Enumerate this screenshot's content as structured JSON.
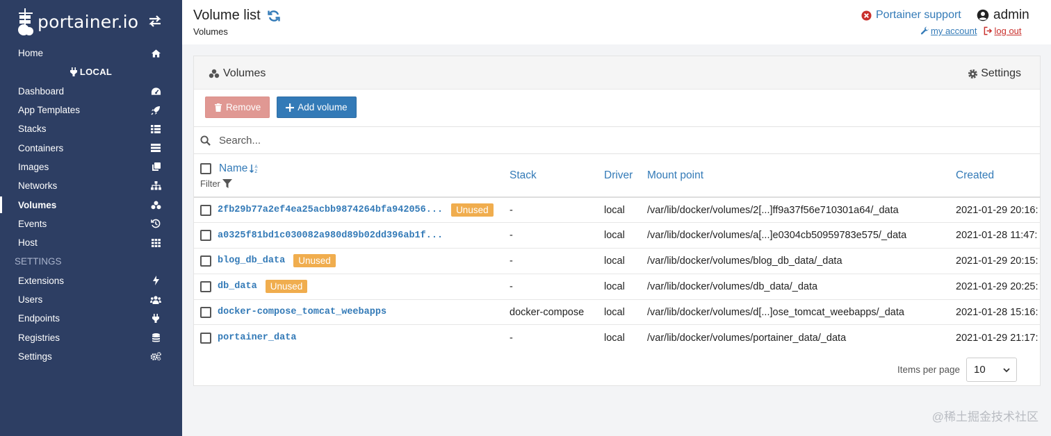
{
  "brand": {
    "text": "portainer.io"
  },
  "sidebar": {
    "home": "Home",
    "endpoint": "LOCAL",
    "items": [
      {
        "label": "Dashboard",
        "icon": "dashboard-icon"
      },
      {
        "label": "App Templates",
        "icon": "rocket-icon"
      },
      {
        "label": "Stacks",
        "icon": "th-list-icon"
      },
      {
        "label": "Containers",
        "icon": "server-icon"
      },
      {
        "label": "Images",
        "icon": "clone-icon"
      },
      {
        "label": "Networks",
        "icon": "sitemap-icon"
      },
      {
        "label": "Volumes",
        "icon": "cubes-icon",
        "active": true
      },
      {
        "label": "Events",
        "icon": "history-icon"
      },
      {
        "label": "Host",
        "icon": "th-icon"
      }
    ],
    "settings_section": "SETTINGS",
    "settings_items": [
      {
        "label": "Extensions",
        "icon": "bolt-icon"
      },
      {
        "label": "Users",
        "icon": "users-icon"
      },
      {
        "label": "Endpoints",
        "icon": "plug-icon"
      },
      {
        "label": "Registries",
        "icon": "database-icon"
      },
      {
        "label": "Settings",
        "icon": "cogs-icon"
      }
    ]
  },
  "header": {
    "title": "Volume list",
    "breadcrumb": "Volumes",
    "support": "Portainer support",
    "user": "admin",
    "my_account": "my account",
    "log_out": "log out"
  },
  "panel": {
    "title": "Volumes",
    "settings": "Settings",
    "remove_label": "Remove",
    "add_label": "Add volume",
    "search_placeholder": "Search...",
    "columns": {
      "name": "Name",
      "filter": "Filter",
      "stack": "Stack",
      "driver": "Driver",
      "mount": "Mount point",
      "created": "Created"
    },
    "rows": [
      {
        "name": "2fb29b77a2ef4ea25acbb9874264bfa942056...",
        "badge": "Unused",
        "stack": "-",
        "driver": "local",
        "mount": "/var/lib/docker/volumes/2[...]ff9a37f56e710301a64/_data",
        "created": "2021-01-29 20:16:"
      },
      {
        "name": "a0325f81bd1c030082a980d89b02dd396ab1f...",
        "badge": "",
        "stack": "-",
        "driver": "local",
        "mount": "/var/lib/docker/volumes/a[...]e0304cb50959783e575/_data",
        "created": "2021-01-28 11:47:"
      },
      {
        "name": "blog_db_data",
        "badge": "Unused",
        "stack": "-",
        "driver": "local",
        "mount": "/var/lib/docker/volumes/blog_db_data/_data",
        "created": "2021-01-29 20:15:"
      },
      {
        "name": "db_data",
        "badge": "Unused",
        "stack": "-",
        "driver": "local",
        "mount": "/var/lib/docker/volumes/db_data/_data",
        "created": "2021-01-29 20:25:"
      },
      {
        "name": "docker-compose_tomcat_weebapps",
        "badge": "",
        "stack": "docker-compose",
        "driver": "local",
        "mount": "/var/lib/docker/volumes/d[...]ose_tomcat_weebapps/_data",
        "created": "2021-01-28 15:16:"
      },
      {
        "name": "portainer_data",
        "badge": "",
        "stack": "-",
        "driver": "local",
        "mount": "/var/lib/docker/volumes/portainer_data/_data",
        "created": "2021-01-29 21:17:"
      }
    ],
    "items_per_page_label": "Items per page",
    "items_per_page_value": "10"
  },
  "watermark": "@稀土掘金技术社区",
  "colors": {
    "sidebar": "#2d3e63",
    "link": "#337ab7",
    "badge": "#f0ad4e",
    "danger": "#e09893"
  }
}
